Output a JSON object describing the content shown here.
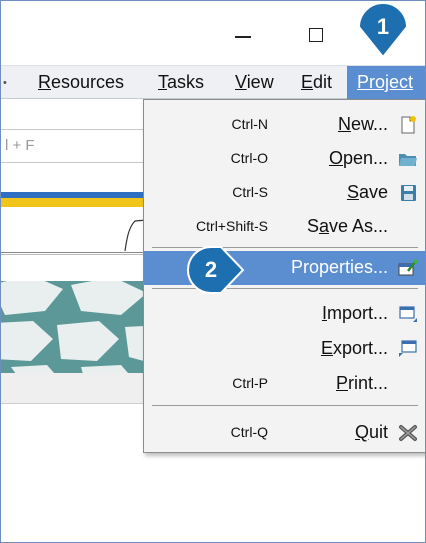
{
  "menubar": {
    "items": [
      {
        "label": "Resources"
      },
      {
        "label": "Tasks"
      },
      {
        "label": "View"
      },
      {
        "label": "Edit"
      },
      {
        "label": "Project"
      }
    ]
  },
  "background": {
    "search_fragment": "l + F"
  },
  "project_menu": {
    "items": [
      {
        "shortcut": "Ctrl-N",
        "label": "New..."
      },
      {
        "shortcut": "Ctrl-O",
        "label": "Open..."
      },
      {
        "shortcut": "Ctrl-S",
        "label": "Save"
      },
      {
        "shortcut": "Ctrl+Shift-S",
        "label": "Save As..."
      },
      {
        "shortcut": "",
        "label": "Properties..."
      },
      {
        "shortcut": "",
        "label": "Import..."
      },
      {
        "shortcut": "",
        "label": "Export..."
      },
      {
        "shortcut": "Ctrl-P",
        "label": "Print..."
      },
      {
        "shortcut": "Ctrl-Q",
        "label": "Quit"
      }
    ]
  },
  "callouts": {
    "step1": "1",
    "step2": "2"
  },
  "colors": {
    "menu_highlight": "#5b8ed1",
    "callout_blue": "#1e6fb0",
    "stripe_blue": "#2f6fc2",
    "stripe_yellow": "#f0c419"
  }
}
